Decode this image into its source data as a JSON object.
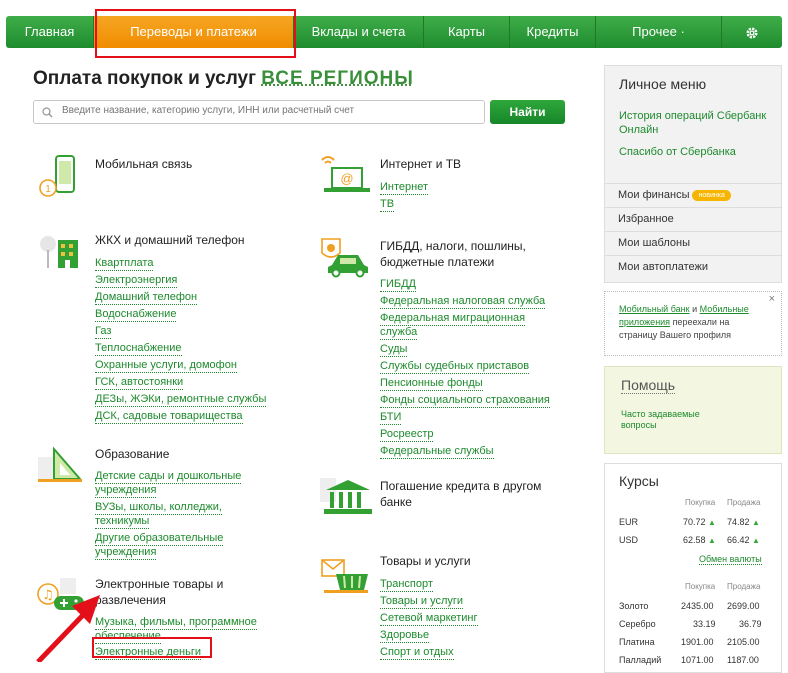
{
  "nav": {
    "items": [
      "Главная",
      "Переводы и платежи",
      "Вклады и счета",
      "Карты",
      "Кредиты",
      "Прочее ·"
    ],
    "active_index": 1,
    "settings_icon": "gear-icon"
  },
  "page": {
    "title": "Оплата покупок и услуг",
    "regions": "ВСЕ РЕГИОНЫ",
    "search_placeholder": "Введите название, категорию услуги, ИНН или расчетный счет",
    "search_button": "Найти"
  },
  "categories": {
    "mobile": {
      "title": "Мобильная связь",
      "icon": "mobile-phone-icon",
      "links": []
    },
    "internet": {
      "title": "Интернет и ТВ",
      "icon": "laptop-email-icon",
      "links": [
        "Интернет",
        "ТВ"
      ]
    },
    "housing": {
      "title": "ЖКХ и домашний телефон",
      "icon": "house-icon",
      "links": [
        "Квартплата",
        "Электроэнергия",
        "Домашний телефон",
        "Водоснабжение",
        "Газ",
        "Теплоснабжение",
        "Охранные услуги, домофон",
        "ГСК, автостоянки",
        "ДЕЗы, ЖЭКи, ремонтные службы",
        "ДСК, садовые товарищества"
      ]
    },
    "gibdd": {
      "title_line1": "ГИБДД, налоги, пошлины,",
      "title_line2": "бюджетные платежи",
      "icon": "car-icon",
      "links": [
        "ГИБДД",
        "Федеральная налоговая служба",
        "Федеральная миграционная",
        "служба",
        "Суды",
        "Службы судебных приставов",
        "Пенсионные фонды",
        "Фонды социального страхования",
        "БТИ",
        "Росреестр",
        "Федеральные службы"
      ]
    },
    "education": {
      "title": "Образование",
      "icon": "ruler-triangle-icon",
      "links": [
        "Детские сады и дошкольные",
        "учреждения",
        "ВУЗы, школы, колледжи,",
        "техникумы",
        "Другие образовательные",
        "учреждения"
      ]
    },
    "credit": {
      "title_line1": "Погашение кредита в другом",
      "title_line2": "банке",
      "icon": "bank-building-icon"
    },
    "goods": {
      "title": "Товары и услуги",
      "icon": "shopping-basket-icon",
      "links": [
        "Транспорт",
        "Товары и услуги",
        "Сетевой маркетинг",
        "Здоровье",
        "Спорт и отдых"
      ]
    },
    "entertainment": {
      "title_line1": "Электронные товары и",
      "title_line2": "развлечения",
      "icon": "music-gamepad-icon",
      "links": [
        "Музыка, фильмы, программное",
        "обеспечение",
        "Электронные деньги"
      ]
    }
  },
  "sidebar": {
    "title": "Личное меню",
    "links": [
      "История операций Сбербанк",
      "Онлайн",
      "Спасибо от Сбербанка"
    ],
    "menu": [
      "Мои финансы",
      "Избранное",
      "Мои шаблоны",
      "Мои автоплатежи"
    ],
    "new_badge": "новинка",
    "notice": {
      "part1": "Мобильный банк",
      "and": " и ",
      "part2": "Мобильные",
      "part3": "приложения",
      "rest1": " переехали на",
      "rest2": "страницу Вашего профиля",
      "close": "×"
    },
    "help_title": "Помощь",
    "help_link1": "Часто задаваемые",
    "help_link2": "вопросы"
  },
  "rates": {
    "title": "Курсы",
    "buy": "Покупка",
    "sell": "Продажа",
    "currencies": [
      {
        "name": "EUR",
        "buy": "70.72",
        "sell": "74.82"
      },
      {
        "name": "USD",
        "buy": "62.58",
        "sell": "66.42"
      }
    ],
    "exchange_link": "Обмен валюты",
    "metals": [
      {
        "name": "Золото",
        "buy": "2435.00",
        "sell": "2699.00"
      },
      {
        "name": "Серебро",
        "buy": "33.19",
        "sell": "36.79"
      },
      {
        "name": "Платина",
        "buy": "1901.00",
        "sell": "2105.00"
      },
      {
        "name": "Палладий",
        "buy": "1071.00",
        "sell": "1187.00"
      }
    ],
    "up_arrow": "▲"
  },
  "colors": {
    "green": "#1d8a2d",
    "orange": "#f39a12",
    "red_highlight": "#e3101a"
  }
}
